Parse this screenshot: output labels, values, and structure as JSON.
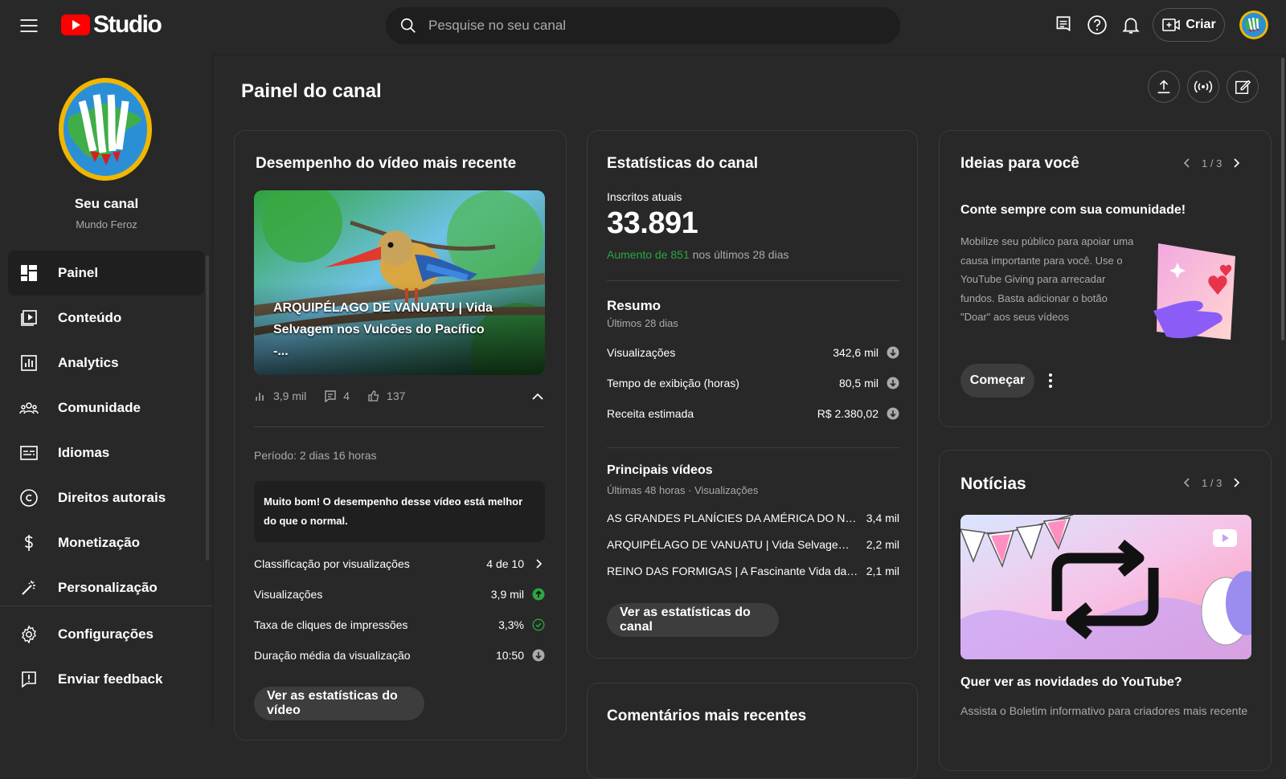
{
  "header": {
    "logo_text": "Studio",
    "search_placeholder": "Pesquise no seu canal",
    "create_label": "Criar"
  },
  "sidebar": {
    "channel_title": "Seu canal",
    "channel_name": "Mundo Feroz",
    "items": [
      {
        "label": "Painel",
        "icon": "dashboard-icon",
        "active": true
      },
      {
        "label": "Conteúdo",
        "icon": "content-icon"
      },
      {
        "label": "Analytics",
        "icon": "analytics-icon"
      },
      {
        "label": "Comunidade",
        "icon": "community-icon"
      },
      {
        "label": "Idiomas",
        "icon": "subtitles-icon"
      },
      {
        "label": "Direitos autorais",
        "icon": "copyright-icon"
      },
      {
        "label": "Monetização",
        "icon": "dollar-icon"
      },
      {
        "label": "Personalização",
        "icon": "wand-icon"
      }
    ],
    "bottom_items": [
      {
        "label": "Configurações",
        "icon": "gear-icon"
      },
      {
        "label": "Enviar feedback",
        "icon": "feedback-icon"
      }
    ]
  },
  "page": {
    "title": "Painel do canal"
  },
  "latest_video": {
    "card_title": "Desempenho do vídeo mais recente",
    "video_title": "ARQUIPÉLAGO DE VANUATU | Vida Selvagem nos Vulcões do Pacífico -...",
    "views": "3,9 mil",
    "comments": "4",
    "likes": "137",
    "period": "Período: 2 dias 16 horas",
    "callout": "Muito bom! O desempenho desse vídeo está melhor do que o normal.",
    "metrics": [
      {
        "label": "Classificação por visualizações",
        "value": "4 de 10"
      },
      {
        "label": "Visualizações",
        "value": "3,9 mil"
      },
      {
        "label": "Taxa de cliques de impressões",
        "value": "3,3%"
      },
      {
        "label": "Duração média da visualização",
        "value": "10:50"
      }
    ],
    "button": "Ver as estatísticas do vídeo"
  },
  "channel_stats": {
    "card_title": "Estatísticas do canal",
    "subs_label": "Inscritos atuais",
    "subs_value": "33.891",
    "increase_highlight": "Aumento de 851",
    "increase_rest": " nos últimos 28 dias",
    "summary_title": "Resumo",
    "summary_period": "Últimos 28 dias",
    "summary": [
      {
        "label": "Visualizações",
        "value": "342,6 mil"
      },
      {
        "label": "Tempo de exibição (horas)",
        "value": "80,5 mil"
      },
      {
        "label": "Receita estimada",
        "value": "R$ 2.380,02"
      }
    ],
    "top_title": "Principais vídeos",
    "top_period": "Últimas 48 horas · Visualizações",
    "top_videos": [
      {
        "title": "AS GRANDES PLANÍCIES DA AMÉRICA DO NORTE | Vida Selvagem",
        "views": "3,4 mil"
      },
      {
        "title": "ARQUIPÉLAGO DE VANUATU | Vida Selvagem nos Vulcões do Pacífico",
        "views": "2,2 mil"
      },
      {
        "title": "REINO DAS FORMIGAS | A Fascinante Vida das Formigas",
        "views": "2,1 mil"
      }
    ],
    "button": "Ver as estatísticas do canal"
  },
  "comments_card": {
    "title": "Comentários mais recentes"
  },
  "ideas": {
    "card_title": "Ideias para você",
    "pager": "1 / 3",
    "headline": "Conte sempre com sua comunidade!",
    "body": "Mobilize seu público para apoiar uma causa importante para você. Use o YouTube Giving para arrecadar fundos. Basta adicionar o botão \"Doar\" aos seus vídeos",
    "button": "Começar"
  },
  "news": {
    "card_title": "Notícias",
    "pager": "1 / 3",
    "headline": "Quer ver as novidades do YouTube?",
    "body": "Assista o Boletim informativo para criadores mais recente"
  },
  "colors": {
    "background": "#282828",
    "accent_red": "#ff0000",
    "positive_green": "#2ba640"
  }
}
